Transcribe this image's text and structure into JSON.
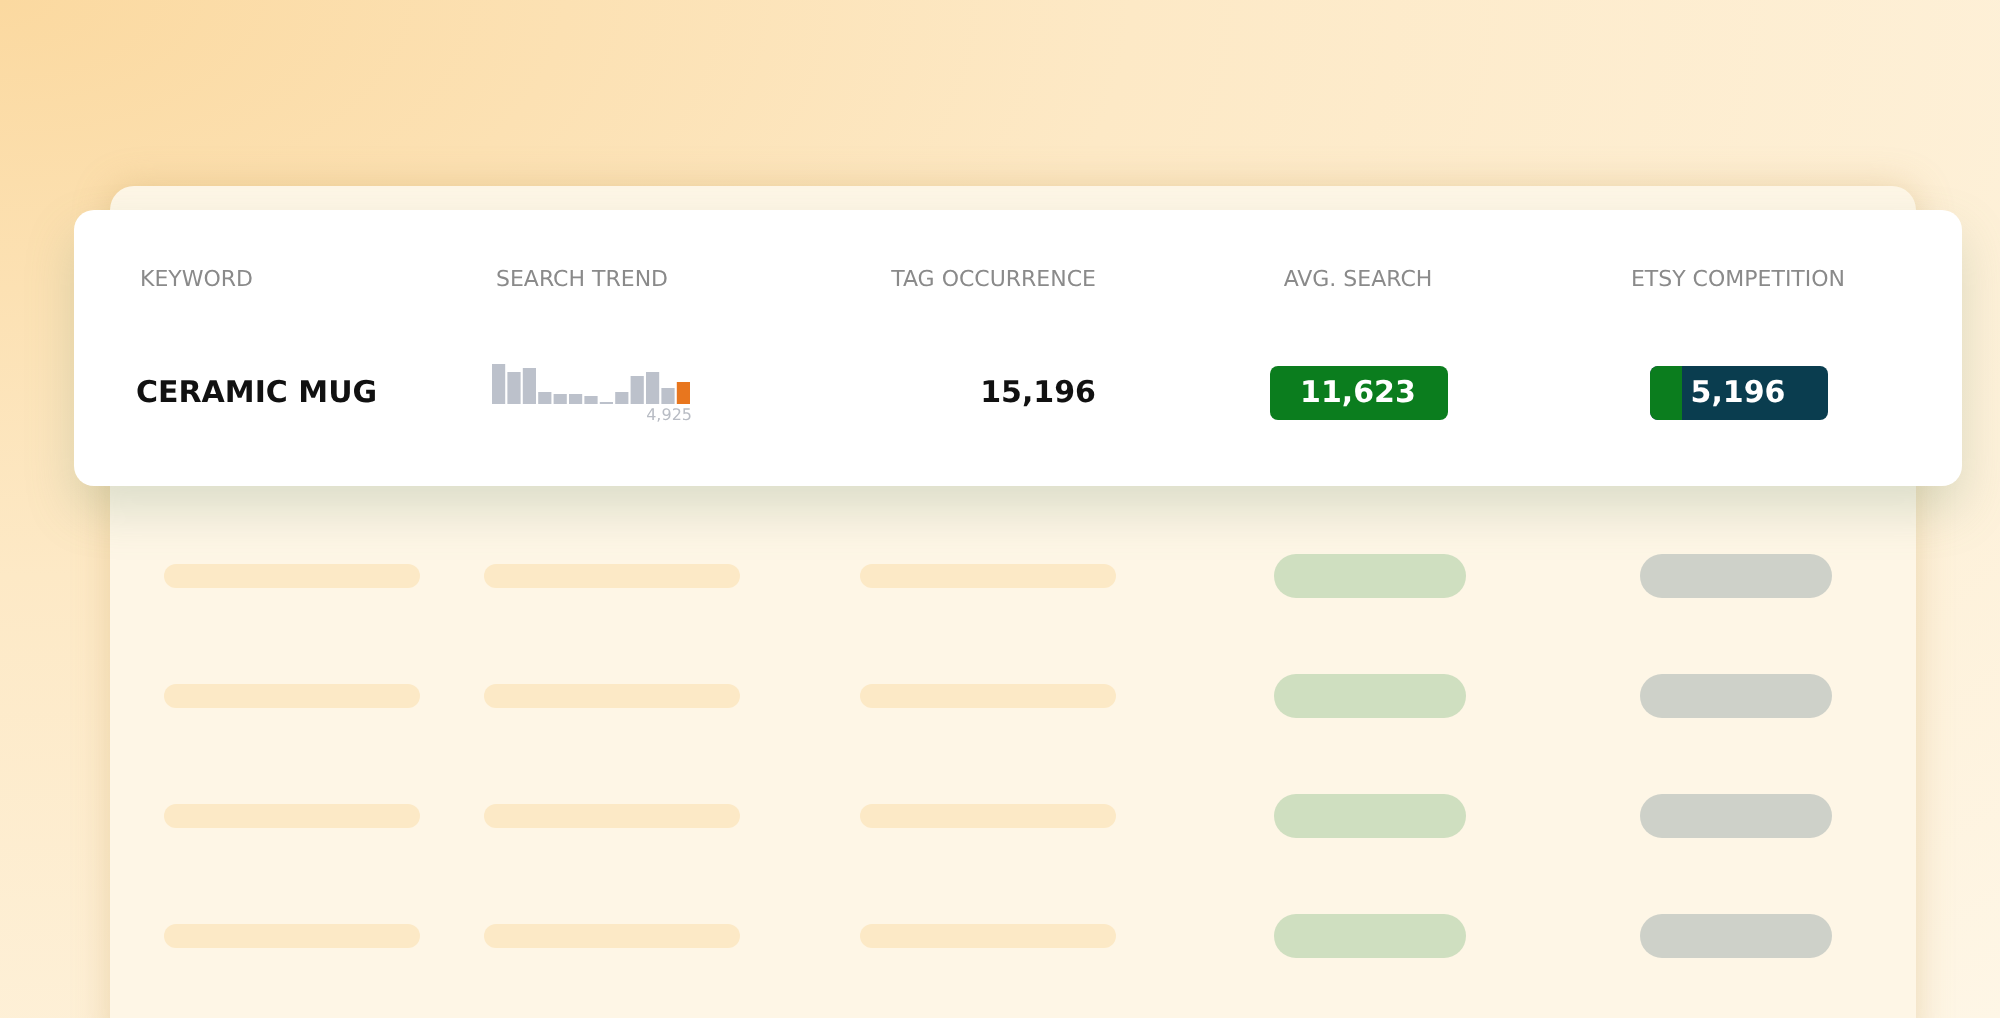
{
  "table": {
    "columns": [
      "KEYWORD",
      "SEARCH TREND",
      "TAG OCCURRENCE",
      "AVG. SEARCH",
      "ETSY COMPETITION"
    ],
    "rows": [
      {
        "keyword": "CERAMIC MUG",
        "trend_label": "4,925",
        "tag_occurrence": "15,196",
        "avg_search": "11,623",
        "competition": {
          "value": "5,196",
          "level": 0.18
        }
      }
    ]
  }
}
